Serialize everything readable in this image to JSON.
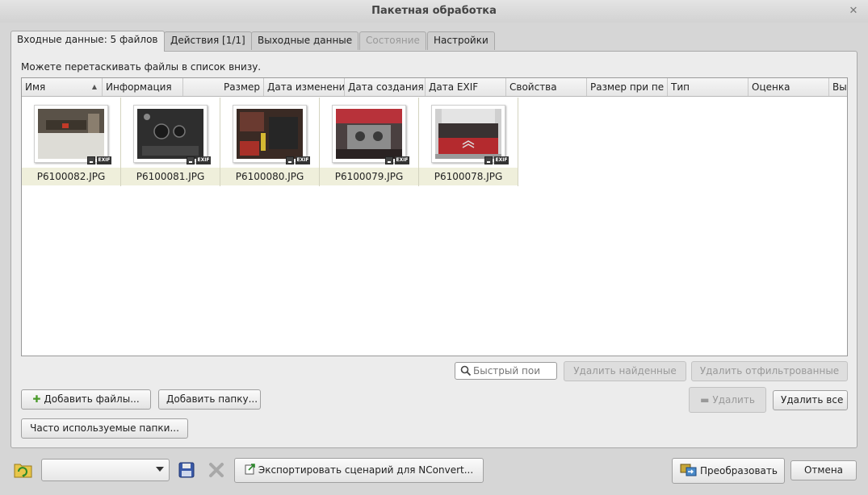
{
  "window": {
    "title": "Пакетная обработка"
  },
  "tabs": [
    {
      "label": "Входные данные: 5 файлов",
      "active": true
    },
    {
      "label": "Действия [1/1]"
    },
    {
      "label": "Выходные данные"
    },
    {
      "label": "Состояние",
      "disabled": true
    },
    {
      "label": "Настройки"
    }
  ],
  "input": {
    "hint": "Можете перетаскивать файлы в список внизу.",
    "columns": [
      "Имя",
      "Информация",
      "Размер",
      "Дата изменения",
      "Дата создания",
      "Дата EXIF",
      "Свойства",
      "Размер при пе",
      "Тип",
      "Оценка",
      "Вы"
    ],
    "files": [
      {
        "name": "P6100082.JPG",
        "badge": "EXIF"
      },
      {
        "name": "P6100081.JPG",
        "badge": "EXIF"
      },
      {
        "name": "P6100080.JPG",
        "badge": "EXIF"
      },
      {
        "name": "P6100079.JPG",
        "badge": "EXIF"
      },
      {
        "name": "P6100078.JPG",
        "badge": "EXIF"
      }
    ],
    "search": {
      "placeholder": "Быстрый пои",
      "value": ""
    },
    "buttons": {
      "remove_found": "Удалить найденные",
      "remove_filtered": "Удалить отфильтрованные",
      "add_files": "Добавить файлы...",
      "add_folder": "Добавить папку...",
      "remove": "Удалить",
      "remove_all": "Удалить все",
      "frequent_folders": "Часто используемые папки..."
    }
  },
  "footer": {
    "preset_value": "",
    "export_label": "Экспортировать сценарий для NConvert...",
    "convert_label": "Преобразовать",
    "cancel_label": "Отмена"
  },
  "icons": {
    "close": "close-icon",
    "sort": "sort-ascending-icon",
    "add": "plus-icon",
    "remove": "minus-icon",
    "search": "search-icon",
    "open_folder": "folder-open-icon",
    "save": "floppy-disk-icon",
    "delete": "delete-x-icon",
    "export": "export-script-icon",
    "convert": "convert-icon"
  }
}
